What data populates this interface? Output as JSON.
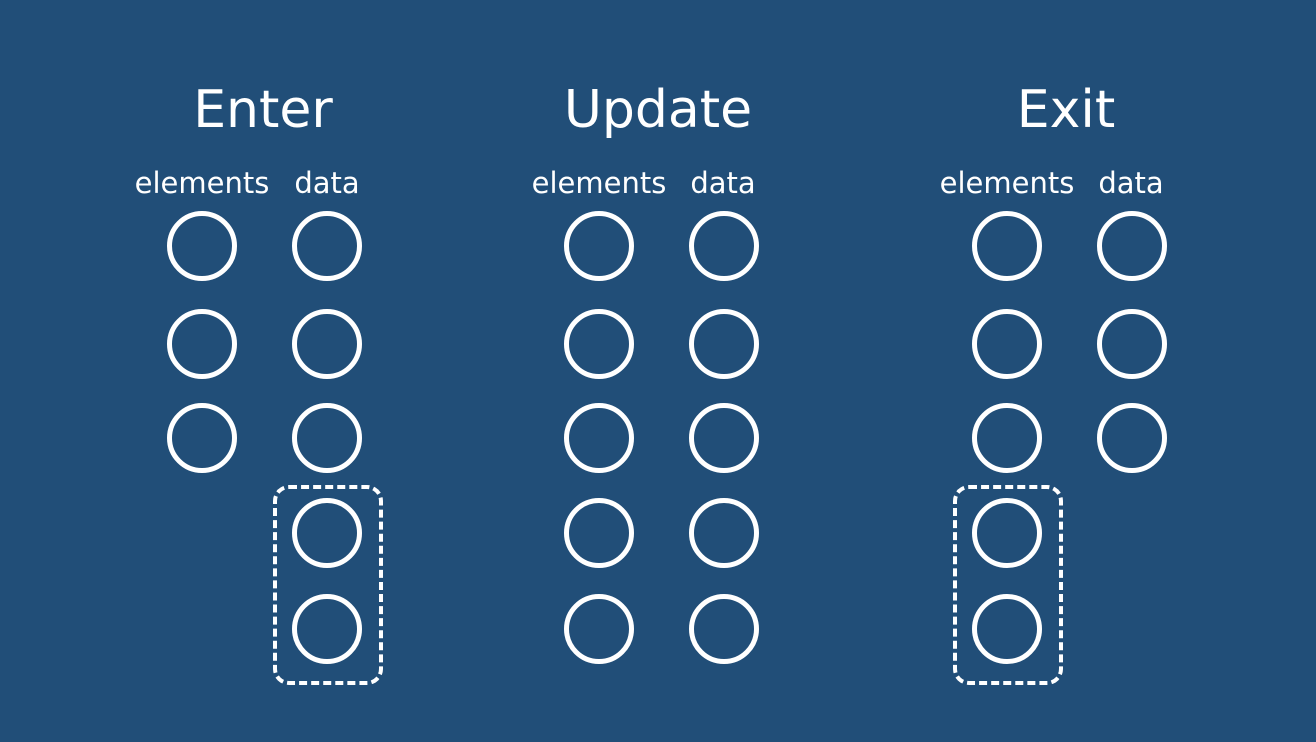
{
  "panels": [
    {
      "title": "Enter",
      "columns": [
        {
          "label": "elements",
          "count": 3
        },
        {
          "label": "data",
          "count": 5
        }
      ],
      "highlight": {
        "column": 1,
        "from": 3,
        "to": 4
      }
    },
    {
      "title": "Update",
      "columns": [
        {
          "label": "elements",
          "count": 5
        },
        {
          "label": "data",
          "count": 5
        }
      ],
      "highlight": null
    },
    {
      "title": "Exit",
      "columns": [
        {
          "label": "elements",
          "count": 5
        },
        {
          "label": "data",
          "count": 3
        }
      ],
      "highlight": {
        "column": 0,
        "from": 3,
        "to": 4
      }
    }
  ],
  "colors": {
    "background": "#214e78",
    "stroke": "#ffffff"
  }
}
